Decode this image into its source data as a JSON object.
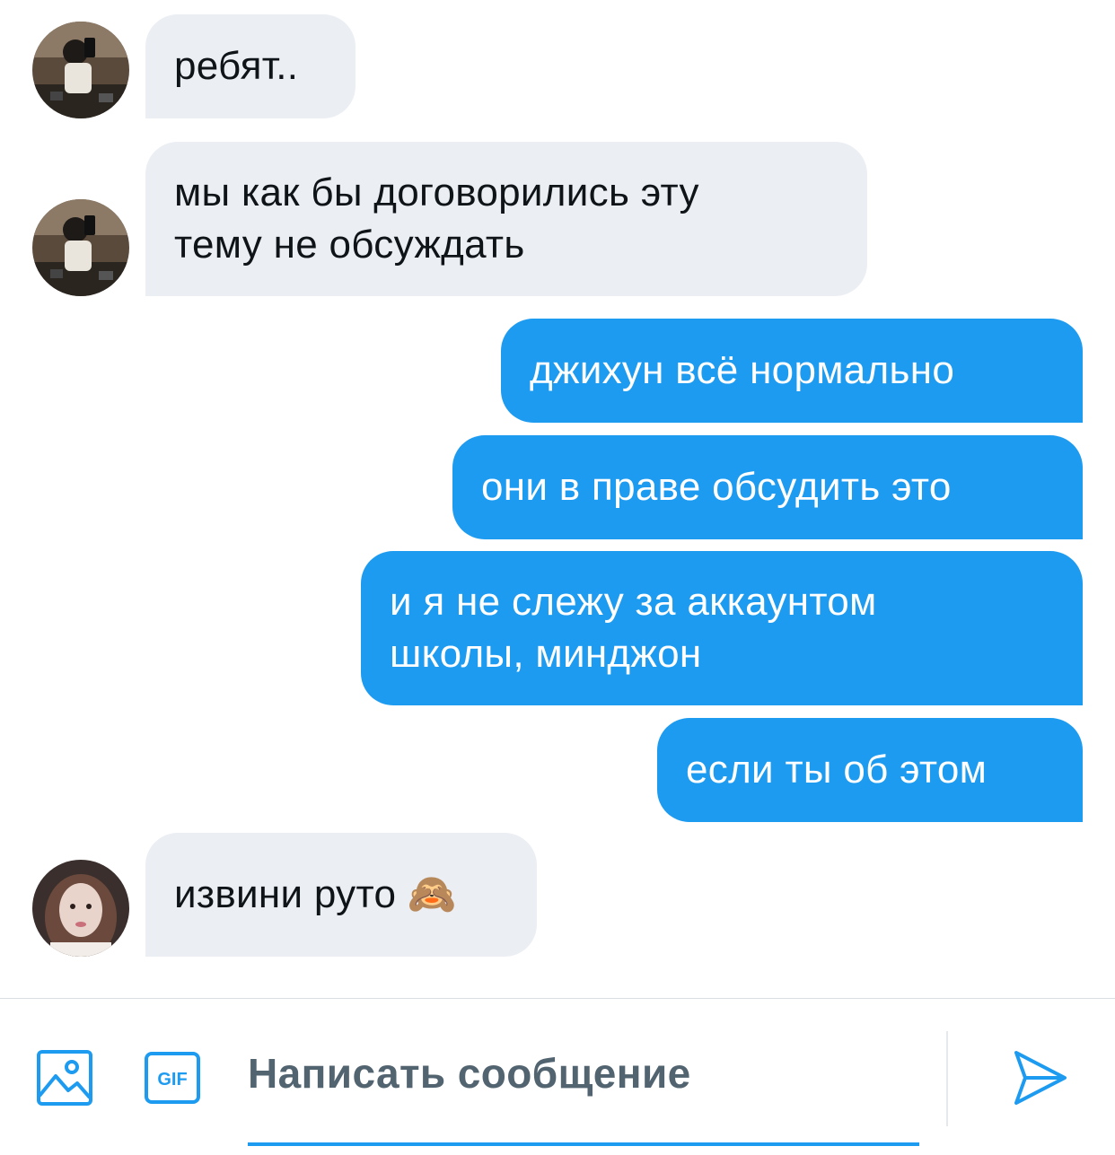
{
  "messages": [
    {
      "side": "in",
      "sender": "other_1",
      "lines": [
        "ребят.."
      ]
    },
    {
      "side": "in",
      "sender": "other_1",
      "lines": [
        "мы как бы договорились эту",
        "тему не обсуждать"
      ]
    },
    {
      "side": "out",
      "lines": [
        "джихун всё нормально"
      ]
    },
    {
      "side": "out",
      "lines": [
        "они в праве обсудить это"
      ]
    },
    {
      "side": "out",
      "lines": [
        "и я не слежу за аккаунтом",
        "школы, минджон"
      ]
    },
    {
      "side": "out",
      "lines": [
        "если ты об этом"
      ]
    },
    {
      "side": "in",
      "sender": "other_2",
      "lines": [
        "извини руто 🙈"
      ]
    }
  ],
  "composer": {
    "placeholder": "Написать сообщение",
    "gif_label": "GIF",
    "icons": [
      "image-icon",
      "gif-icon",
      "send-icon"
    ]
  },
  "colors": {
    "outgoing_bubble": "#1d9bf0",
    "incoming_bubble": "#ebeef3",
    "accent": "#1d9bf0",
    "placeholder_text": "#536471"
  }
}
